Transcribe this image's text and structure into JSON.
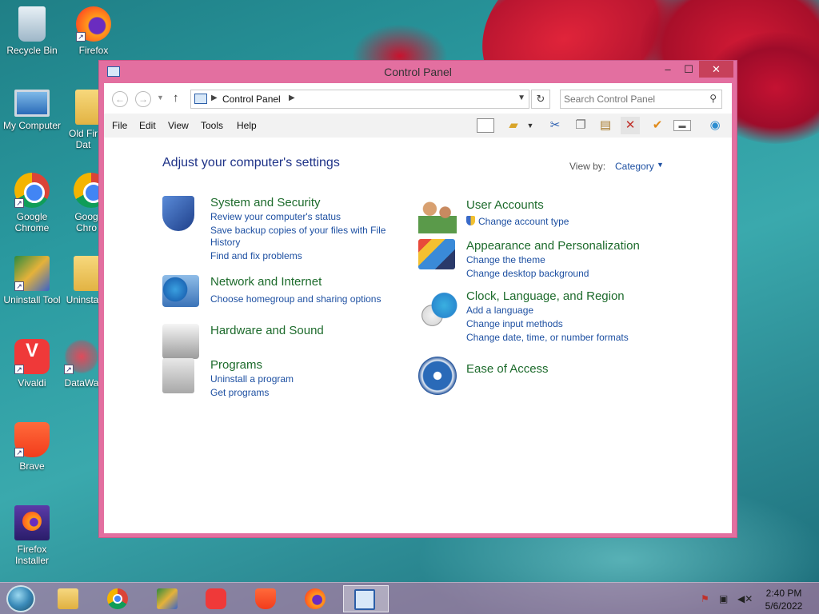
{
  "desktop": {
    "icons": [
      {
        "label": "Recycle Bin",
        "icon": "recycle-bin-icon"
      },
      {
        "label": "Firefox",
        "icon": "firefox-icon"
      },
      {
        "label": "My Computer",
        "icon": "computer-icon"
      },
      {
        "label": "Old Fir Dat",
        "icon": "folder-icon"
      },
      {
        "label": "Google Chrome",
        "icon": "chrome-icon"
      },
      {
        "label": "Goog Chro",
        "icon": "chrome-icon"
      },
      {
        "label": "Uninstall Tool",
        "icon": "uninstall-tool-icon"
      },
      {
        "label": "Uninsta",
        "icon": "folder-icon"
      },
      {
        "label": "Vivaldi",
        "icon": "vivaldi-icon"
      },
      {
        "label": "DataWa",
        "icon": "datawarp-icon"
      },
      {
        "label": "Brave",
        "icon": "brave-icon"
      },
      {
        "label": "Firefox Installer",
        "icon": "firefox-installer-icon"
      }
    ]
  },
  "window": {
    "title": "Control Panel",
    "controls": {
      "minimize": "–",
      "maximize": "☐",
      "close": "✕"
    }
  },
  "address": {
    "crumb": "Control Panel",
    "search_placeholder": "Search Control Panel"
  },
  "menu": {
    "items": [
      "File",
      "Edit",
      "View",
      "Tools",
      "Help"
    ]
  },
  "content": {
    "heading": "Adjust your computer's settings",
    "view_by_label": "View by:",
    "view_by_value": "Category",
    "categories": {
      "system_security": {
        "title": "System and Security",
        "links": [
          "Review your computer's status",
          "Save backup copies of your files with File",
          "History",
          "Find and fix problems"
        ]
      },
      "network_internet": {
        "title": "Network and Internet",
        "links": [
          "Choose homegroup and sharing options"
        ]
      },
      "hardware_sound": {
        "title": "Hardware and Sound",
        "links": []
      },
      "programs": {
        "title": "Programs",
        "links": [
          "Uninstall a program",
          "Get programs"
        ]
      },
      "user_accounts": {
        "title": "User Accounts",
        "links": [
          "Change account type"
        ]
      },
      "appearance": {
        "title": "Appearance and Personalization",
        "links": [
          "Change the theme",
          "Change desktop background"
        ]
      },
      "clock_region": {
        "title": "Clock, Language, and Region",
        "links": [
          "Add a language",
          "Change input methods",
          "Change date, time, or number formats"
        ]
      },
      "ease_access": {
        "title": "Ease of Access",
        "links": []
      }
    }
  },
  "taskbar": {
    "clock_time": "2:40 PM",
    "clock_date": "5/6/2022"
  }
}
